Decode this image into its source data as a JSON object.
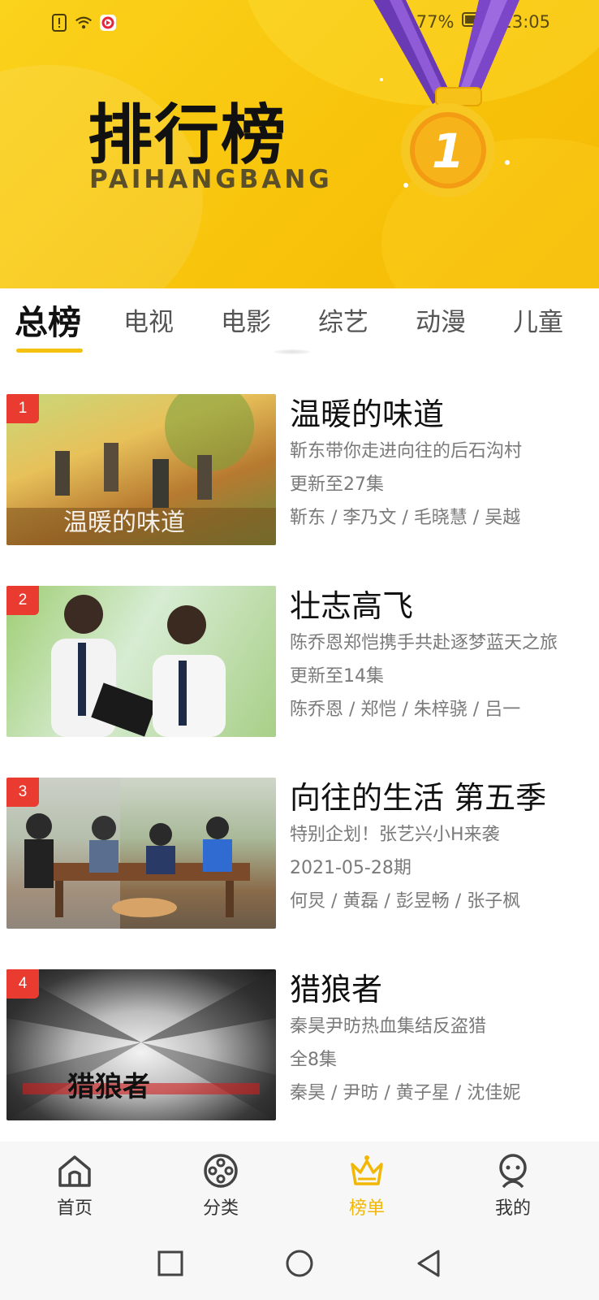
{
  "status": {
    "battery": "77%",
    "time": "13:05"
  },
  "banner": {
    "title": "排行榜",
    "subtitle": "PAIHANGBANG",
    "medal_number": "1"
  },
  "tabs": [
    {
      "label": "总榜",
      "active": true
    },
    {
      "label": "电视"
    },
    {
      "label": "电影"
    },
    {
      "label": "综艺"
    },
    {
      "label": "动漫"
    },
    {
      "label": "儿童"
    }
  ],
  "items": [
    {
      "rank": "1",
      "title": "温暖的味道",
      "desc": "靳东带你走进向往的后石沟村",
      "episode": "更新至27集",
      "cast": "靳东 / 李乃文 / 毛晓慧 / 吴越"
    },
    {
      "rank": "2",
      "title": "壮志高飞",
      "desc": "陈乔恩郑恺携手共赴逐梦蓝天之旅",
      "episode": "更新至14集",
      "cast": "陈乔恩 / 郑恺 / 朱梓骁 / 吕一"
    },
    {
      "rank": "3",
      "title": "向往的生活 第五季",
      "desc": "特别企划！张艺兴小H来袭",
      "episode": "2021-05-28期",
      "cast": "何炅 / 黄磊 / 彭昱畅 / 张子枫"
    },
    {
      "rank": "4",
      "title": "猎狼者",
      "desc": "秦昊尹昉热血集结反盗猎",
      "episode": "全8集",
      "cast": "秦昊 / 尹昉 / 黄子星 / 沈佳妮"
    }
  ],
  "nav": [
    {
      "label": "首页",
      "icon": "home-icon"
    },
    {
      "label": "分类",
      "icon": "film-reel-icon"
    },
    {
      "label": "榜单",
      "icon": "crown-icon",
      "active": true
    },
    {
      "label": "我的",
      "icon": "profile-icon"
    }
  ],
  "colors": {
    "accent": "#f4c10f",
    "rank_badge": "#e93b2f",
    "nav_active": "#f2b705"
  }
}
